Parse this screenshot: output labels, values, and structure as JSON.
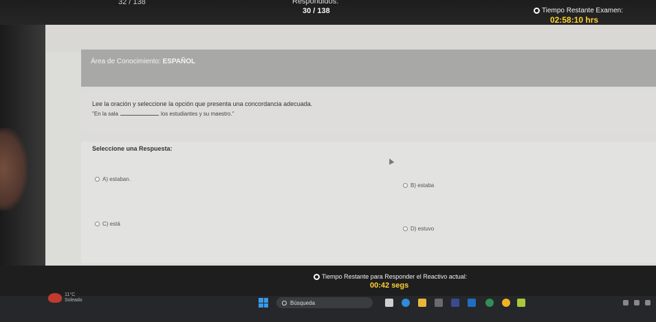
{
  "header": {
    "counter_left": "32 / 138",
    "answered_label": "Respondidos:",
    "progress": "30 / 138",
    "timer_label": "Tiempo Restante Examen:",
    "timer_value": "02:58:10 hrs"
  },
  "area": {
    "prefix": "Área de Conocimiento: ",
    "subject": "ESPAÑOL"
  },
  "question": {
    "instruction": "Lee la oración y seleccione la opción que presenta una concordancia adecuada.",
    "sentence_start": "\"En la sala",
    "sentence_end": "los estudiantes y su maestro.\""
  },
  "answers": {
    "prompt": "Seleccione una Respuesta:",
    "options": [
      {
        "label": "A) estaban."
      },
      {
        "label": "B) estaba"
      },
      {
        "label": "C) está"
      },
      {
        "label": "D) estuvo"
      }
    ]
  },
  "footer": {
    "question_timer_label": "Tiempo Restante para Responder el Reactivo actual:",
    "question_timer_value": "00:42 segs"
  },
  "taskbar": {
    "weather_temp": "11°C",
    "weather_desc": "Soleado",
    "search_placeholder": "Búsqueda"
  },
  "colors": {
    "timer_accent": "#ffd233",
    "area_band": "#a8a8a6"
  }
}
